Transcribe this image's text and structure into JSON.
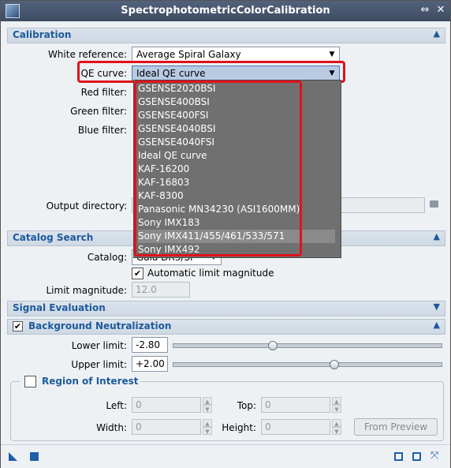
{
  "window": {
    "title": "SpectrophotometricColorCalibration"
  },
  "sections": {
    "calibration": "Calibration",
    "catalog_search": "Catalog Search",
    "signal_evaluation": "Signal Evaluation",
    "background_neutralization": "Background Neutralization"
  },
  "calibration": {
    "white_reference_label": "White reference:",
    "white_reference_value": "Average Spiral Galaxy",
    "qe_curve_label": "QE curve:",
    "qe_curve_value": "Ideal QE curve",
    "red_filter_label": "Red filter:",
    "green_filter_label": "Green filter:",
    "blue_filter_label": "Blue filter:",
    "output_directory_label": "Output directory:"
  },
  "qe_curve_options": [
    "GSENSE2020BSI",
    "GSENSE400BSI",
    "GSENSE400FSI",
    "GSENSE4040BSI",
    "GSENSE4040FSI",
    "Ideal QE curve",
    "KAF-16200",
    "KAF-16803",
    "KAF-8300",
    "Panasonic MN34230 (ASI1600MM)",
    "Sony IMX183",
    "Sony IMX411/455/461/533/571",
    "Sony IMX492"
  ],
  "catalog_search": {
    "catalog_label": "Catalog:",
    "catalog_value": "Gaia DR3/SP",
    "auto_limit_label": "Automatic limit magnitude",
    "limit_magnitude_label": "Limit magnitude:",
    "limit_magnitude_value": "12.0"
  },
  "background": {
    "lower_limit_label": "Lower limit:",
    "lower_limit_value": "-2.80",
    "upper_limit_label": "Upper limit:",
    "upper_limit_value": "+2.00",
    "lower_slider_fraction": 0.37,
    "upper_slider_fraction": 0.6
  },
  "roi": {
    "title": "Region of Interest",
    "left_label": "Left:",
    "left_value": "0",
    "top_label": "Top:",
    "top_value": "0",
    "width_label": "Width:",
    "width_value": "0",
    "height_label": "Height:",
    "height_value": "0",
    "from_preview_label": "From Preview"
  },
  "icons": {
    "checkmark": "✔",
    "combo_arrow": "▼",
    "collapse": "⏶",
    "expand": "⏷"
  },
  "colors": {
    "accent": "#1d5a9c",
    "highlight": "#e0121b",
    "titlebar": "#4a5870"
  }
}
